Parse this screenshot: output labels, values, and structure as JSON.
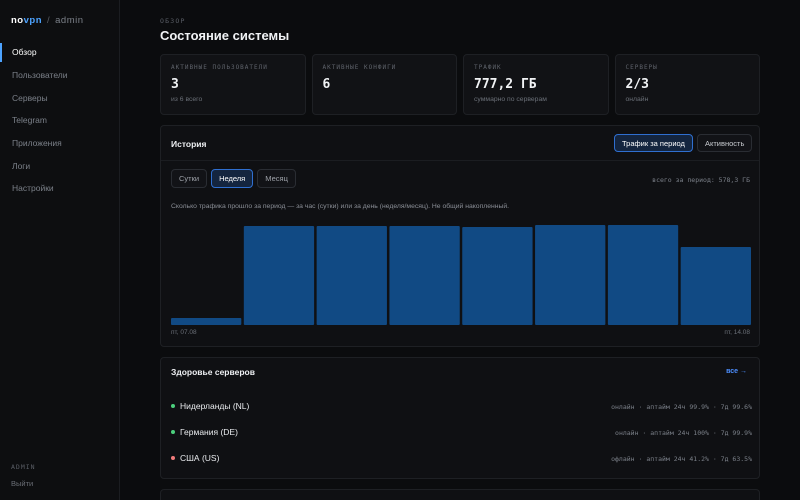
{
  "brand": {
    "part1": "no",
    "part2": "vpn",
    "separator": "/",
    "area": "admin"
  },
  "sidebar": {
    "items": [
      {
        "label": "Обзор",
        "active": true
      },
      {
        "label": "Пользователи"
      },
      {
        "label": "Серверы"
      },
      {
        "label": "Telegram"
      },
      {
        "label": "Приложения"
      },
      {
        "label": "Логи"
      },
      {
        "label": "Настройки"
      }
    ],
    "role": "ADMIN",
    "logout": "Выйти"
  },
  "header": {
    "eyebrow": "ОБЗОР",
    "title": "Состояние системы"
  },
  "stats": [
    {
      "label": "АКТИВНЫЕ ПОЛЬЗОВАТЕЛИ",
      "value": "3",
      "sub": "из 6 всего"
    },
    {
      "label": "АКТИВНЫЕ КОНФИГИ",
      "value": "6",
      "sub": ""
    },
    {
      "label": "ТРАФИК",
      "value": "777,2 ГБ",
      "sub": "суммарно по серверам"
    },
    {
      "label": "СЕРВЕРЫ",
      "value": "2/3",
      "sub": "онлайн"
    }
  ],
  "history": {
    "title": "История",
    "toggle_period": "Трафик за период",
    "toggle_activity": "Активность",
    "tabs": [
      "Сутки",
      "Неделя",
      "Месяц"
    ],
    "active_tab": "Неделя",
    "total": "всего за период: 578,3 ГБ",
    "hint": "Сколько трафика прошло за период — за час (сутки) или за день (неделя/месяц). Не общий накопленный.",
    "x_start": "пт, 07.08",
    "x_end": "пт, 14.08"
  },
  "chart_data": {
    "type": "bar",
    "categories": [
      "пт, 07.08",
      "",
      "",
      "",
      "",
      "",
      "",
      "пт, 14.08"
    ],
    "values": [
      7,
      99,
      99,
      99,
      98,
      100,
      100,
      78
    ],
    "title": "",
    "xlabel": "",
    "ylabel": "",
    "color": "#114a84",
    "grid": false
  },
  "health": {
    "title": "Здоровье серверов",
    "all_link": "все →",
    "servers": [
      {
        "name": "Нидерланды (NL)",
        "meta": "онлайн · аптайм 24ч 99.9% · 7д 99.6%",
        "color": "#4cd07d"
      },
      {
        "name": "Германия (DE)",
        "meta": "онлайн · аптайм 24ч 100% · 7д 99.9%",
        "color": "#4cd07d"
      },
      {
        "name": "США (US)",
        "meta": "офлайн · аптайм 24ч 41.2% · 7д 63.5%",
        "color": "#f07b7b"
      }
    ]
  }
}
